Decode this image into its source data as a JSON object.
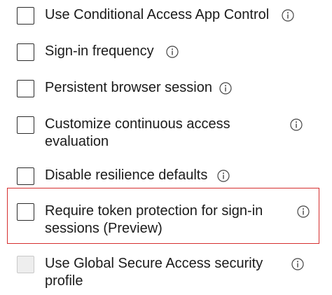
{
  "options": [
    {
      "label": "Use Conditional Access App Control",
      "checked": false,
      "disabled": false,
      "icon": "info-icon"
    },
    {
      "label": "Sign-in frequency",
      "checked": false,
      "disabled": false,
      "icon": "info-icon"
    },
    {
      "label": "Persistent browser session",
      "checked": false,
      "disabled": false,
      "icon": "info-icon"
    },
    {
      "label_line1": "Customize continuous access",
      "label_line2": "evaluation",
      "checked": false,
      "disabled": false,
      "icon": "info-icon"
    },
    {
      "label": "Disable resilience defaults",
      "checked": false,
      "disabled": false,
      "icon": "info-icon"
    },
    {
      "label_line1": "Require token protection for sign-in",
      "label_line2": "sessions (Preview)",
      "checked": false,
      "disabled": false,
      "highlighted": true,
      "icon": "info-icon"
    },
    {
      "label_line1": "Use Global Secure Access security",
      "label_line2": "profile",
      "checked": false,
      "disabled": true,
      "icon": "info-icon"
    }
  ],
  "colors": {
    "text": "#1b1b1b",
    "checkbox_border": "#2b2b2b",
    "checkbox_disabled_fill": "#eeeeee",
    "highlight_border": "#d62f2f",
    "icon": "#444444"
  }
}
